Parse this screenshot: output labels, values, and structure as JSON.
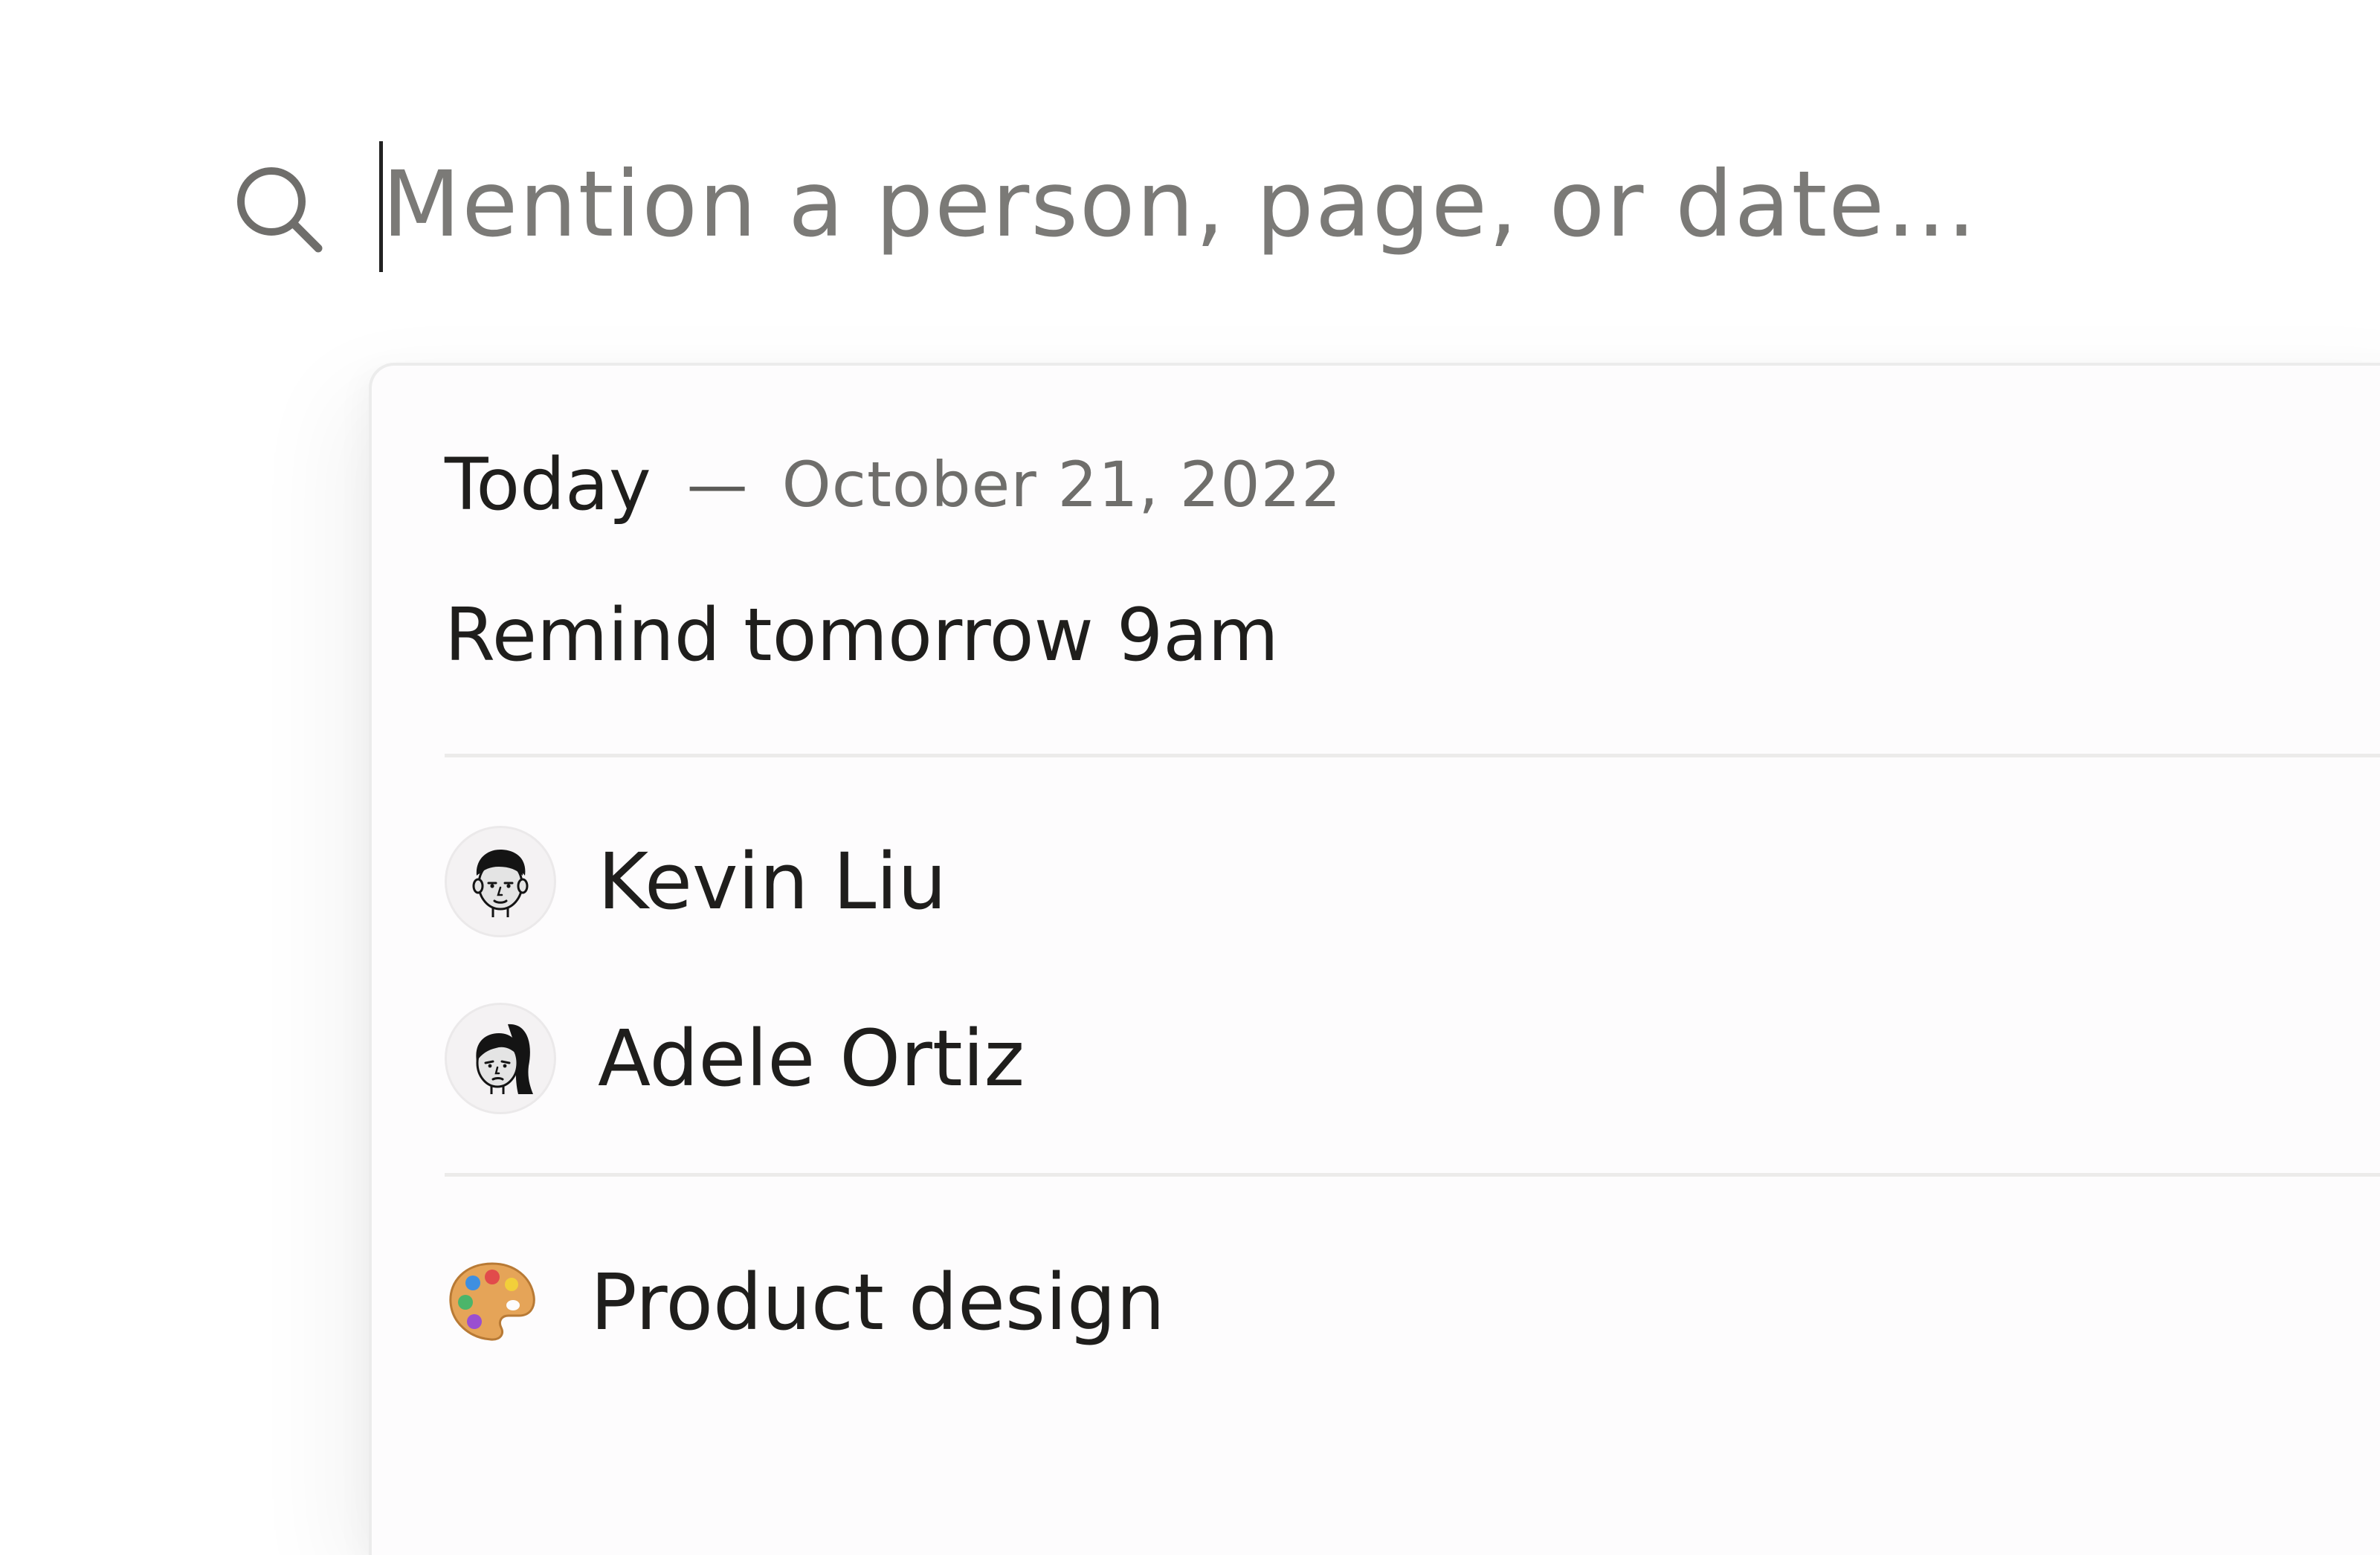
{
  "search": {
    "placeholder": "Mention a person, page, or date…",
    "value": "",
    "icon": "search-icon"
  },
  "suggestions": {
    "today": {
      "label": "Today",
      "separator": "—",
      "date": "October 21, 2022"
    },
    "reminder": {
      "label": "Remind tomorrow 9am"
    },
    "people": [
      {
        "name": "Kevin Liu",
        "icon": "avatar-kevin-icon"
      },
      {
        "name": "Adele Ortiz",
        "icon": "avatar-adele-icon"
      }
    ],
    "pages": [
      {
        "title": "Product design",
        "icon": "artist-palette-icon"
      }
    ]
  },
  "colors": {
    "text_primary": "#1f1e1c",
    "text_secondary": "#6f6e6b",
    "placeholder": "#7b7a77",
    "panel_background": "#fdfcfd",
    "divider": "#ecebea"
  }
}
